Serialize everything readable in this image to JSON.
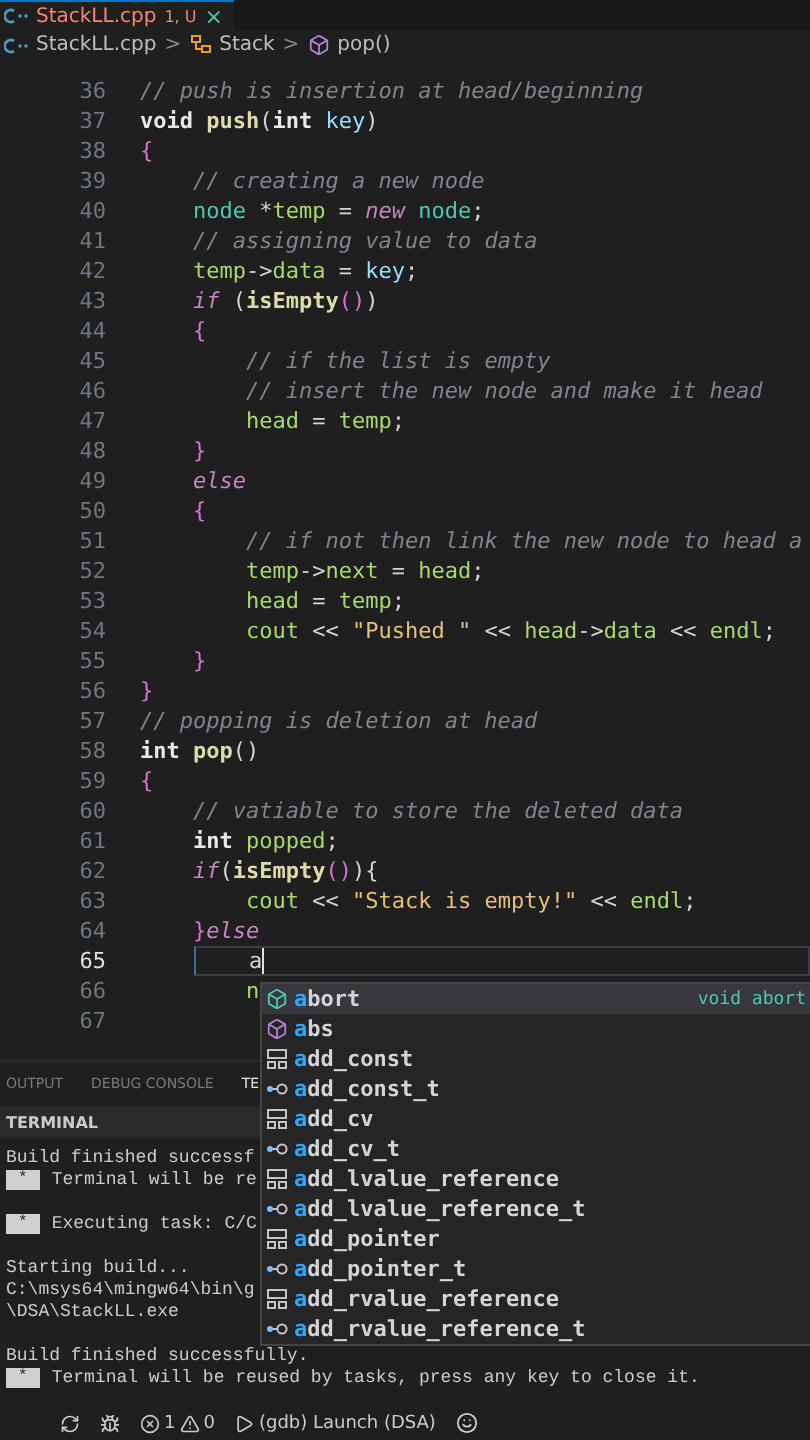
{
  "tab": {
    "file": "StackLL.cpp",
    "badge": "1, U",
    "close": "×"
  },
  "breadcrumb": [
    {
      "kind": "file",
      "label": "StackLL.cpp"
    },
    {
      "kind": "class",
      "label": "Stack"
    },
    {
      "kind": "method",
      "label": "pop()"
    }
  ],
  "separator": ">",
  "code_lines": [
    {
      "number": "36",
      "current": false,
      "tokens": [
        {
          "text": "// push is insertion at head/beginning",
          "kind": "comment"
        }
      ]
    },
    {
      "number": "37",
      "current": false,
      "tokens": [
        {
          "text": "void",
          "kind": "type"
        },
        {
          "text": " push",
          "kind": "func"
        },
        {
          "text": "(",
          "kind": "plain"
        },
        {
          "text": "int",
          "kind": "type"
        },
        {
          "text": " key",
          "kind": "param"
        },
        {
          "text": ")",
          "kind": "plain"
        }
      ]
    },
    {
      "number": "38",
      "current": false,
      "tokens": [
        {
          "text": "{",
          "kind": "brace"
        }
      ]
    },
    {
      "number": "39",
      "current": false,
      "tokens": [
        {
          "text": "    // creating a new node",
          "kind": "comment"
        }
      ]
    },
    {
      "number": "40",
      "current": false,
      "tokens": [
        {
          "text": "    node",
          "kind": "class"
        },
        {
          "text": " *",
          "kind": "plain"
        },
        {
          "text": "temp",
          "kind": "var"
        },
        {
          "text": " = ",
          "kind": "plain"
        },
        {
          "text": "new",
          "kind": "keyword"
        },
        {
          "text": " node",
          "kind": "class"
        },
        {
          "text": ";",
          "kind": "plain"
        }
      ]
    },
    {
      "number": "41",
      "current": false,
      "tokens": [
        {
          "text": "    // assigning value to data",
          "kind": "comment"
        }
      ]
    },
    {
      "number": "42",
      "current": false,
      "tokens": [
        {
          "text": "    temp",
          "kind": "var"
        },
        {
          "text": "->",
          "kind": "plain"
        },
        {
          "text": "data",
          "kind": "var"
        },
        {
          "text": " = ",
          "kind": "plain"
        },
        {
          "text": "key",
          "kind": "param"
        },
        {
          "text": ";",
          "kind": "plain"
        }
      ]
    },
    {
      "number": "43",
      "current": false,
      "tokens": [
        {
          "text": "    if",
          "kind": "keyword"
        },
        {
          "text": " (",
          "kind": "plain"
        },
        {
          "text": "isEmpty",
          "kind": "func"
        },
        {
          "text": "()",
          "kind": "brace"
        },
        {
          "text": ")",
          "kind": "plain"
        }
      ]
    },
    {
      "number": "44",
      "current": false,
      "tokens": [
        {
          "text": "    {",
          "kind": "brace"
        }
      ]
    },
    {
      "number": "45",
      "current": false,
      "tokens": [
        {
          "text": "        // if the list is empty",
          "kind": "comment"
        }
      ]
    },
    {
      "number": "46",
      "current": false,
      "tokens": [
        {
          "text": "        // insert the new node and make it head",
          "kind": "comment"
        }
      ]
    },
    {
      "number": "47",
      "current": false,
      "tokens": [
        {
          "text": "        head",
          "kind": "var"
        },
        {
          "text": " = ",
          "kind": "plain"
        },
        {
          "text": "temp",
          "kind": "var"
        },
        {
          "text": ";",
          "kind": "plain"
        }
      ]
    },
    {
      "number": "48",
      "current": false,
      "tokens": [
        {
          "text": "    }",
          "kind": "brace"
        }
      ]
    },
    {
      "number": "49",
      "current": false,
      "tokens": [
        {
          "text": "    else",
          "kind": "keyword"
        }
      ]
    },
    {
      "number": "50",
      "current": false,
      "tokens": [
        {
          "text": "    {",
          "kind": "brace"
        }
      ]
    },
    {
      "number": "51",
      "current": false,
      "tokens": [
        {
          "text": "        // if not then link the new node to head a",
          "kind": "comment"
        }
      ]
    },
    {
      "number": "52",
      "current": false,
      "tokens": [
        {
          "text": "        temp",
          "kind": "var"
        },
        {
          "text": "->",
          "kind": "plain"
        },
        {
          "text": "next",
          "kind": "var"
        },
        {
          "text": " = ",
          "kind": "plain"
        },
        {
          "text": "head",
          "kind": "var"
        },
        {
          "text": ";",
          "kind": "plain"
        }
      ]
    },
    {
      "number": "53",
      "current": false,
      "tokens": [
        {
          "text": "        head",
          "kind": "var"
        },
        {
          "text": " = ",
          "kind": "plain"
        },
        {
          "text": "temp",
          "kind": "var"
        },
        {
          "text": ";",
          "kind": "plain"
        }
      ]
    },
    {
      "number": "54",
      "current": false,
      "tokens": [
        {
          "text": "        cout",
          "kind": "var"
        },
        {
          "text": " << ",
          "kind": "plain"
        },
        {
          "text": "\"Pushed \"",
          "kind": "string"
        },
        {
          "text": " << ",
          "kind": "plain"
        },
        {
          "text": "head",
          "kind": "var"
        },
        {
          "text": "->",
          "kind": "plain"
        },
        {
          "text": "data",
          "kind": "var"
        },
        {
          "text": " << ",
          "kind": "plain"
        },
        {
          "text": "endl",
          "kind": "var"
        },
        {
          "text": ";",
          "kind": "plain"
        }
      ]
    },
    {
      "number": "55",
      "current": false,
      "tokens": [
        {
          "text": "    }",
          "kind": "brace"
        }
      ]
    },
    {
      "number": "56",
      "current": false,
      "tokens": [
        {
          "text": "}",
          "kind": "brace"
        }
      ]
    },
    {
      "number": "57",
      "current": false,
      "tokens": [
        {
          "text": "// popping is deletion at head",
          "kind": "comment"
        }
      ]
    },
    {
      "number": "58",
      "current": false,
      "tokens": [
        {
          "text": "int",
          "kind": "type"
        },
        {
          "text": " pop",
          "kind": "func"
        },
        {
          "text": "()",
          "kind": "plain"
        }
      ]
    },
    {
      "number": "59",
      "current": false,
      "tokens": [
        {
          "text": "{",
          "kind": "brace"
        }
      ]
    },
    {
      "number": "60",
      "current": false,
      "tokens": [
        {
          "text": "    // vatiable to store the deleted data",
          "kind": "comment"
        }
      ]
    },
    {
      "number": "61",
      "current": false,
      "tokens": [
        {
          "text": "    int",
          "kind": "type"
        },
        {
          "text": " popped",
          "kind": "var"
        },
        {
          "text": ";",
          "kind": "plain"
        }
      ]
    },
    {
      "number": "62",
      "current": false,
      "tokens": [
        {
          "text": "    if",
          "kind": "keyword"
        },
        {
          "text": "(",
          "kind": "plain"
        },
        {
          "text": "isEmpty",
          "kind": "func"
        },
        {
          "text": "()",
          "kind": "brace"
        },
        {
          "text": "){",
          "kind": "plain"
        }
      ]
    },
    {
      "number": "63",
      "current": false,
      "tokens": [
        {
          "text": "        cout",
          "kind": "var"
        },
        {
          "text": " << ",
          "kind": "plain"
        },
        {
          "text": "\"Stack is empty!\"",
          "kind": "string"
        },
        {
          "text": " << ",
          "kind": "plain"
        },
        {
          "text": "endl",
          "kind": "var"
        },
        {
          "text": ";",
          "kind": "plain"
        }
      ]
    },
    {
      "number": "64",
      "current": false,
      "tokens": [
        {
          "text": "    }",
          "kind": "brace"
        },
        {
          "text": "else",
          "kind": "keyword"
        }
      ]
    },
    {
      "number": "65",
      "current": true,
      "tokens": [
        {
          "text": "        a",
          "kind": "plain"
        }
      ]
    },
    {
      "number": "66",
      "current": false,
      "tokens": [
        {
          "text": "        n",
          "kind": "var"
        }
      ]
    },
    {
      "number": "67",
      "current": false
    }
  ],
  "suggestions": [
    {
      "label": "abort",
      "kind": "function",
      "selected": true,
      "detail": "void abort"
    },
    {
      "label": "abs",
      "kind": "function",
      "selected": false
    },
    {
      "label": "add_const",
      "kind": "struct",
      "selected": false
    },
    {
      "label": "add_const_t",
      "kind": "typedef",
      "selected": false
    },
    {
      "label": "add_cv",
      "kind": "struct",
      "selected": false
    },
    {
      "label": "add_cv_t",
      "kind": "typedef",
      "selected": false
    },
    {
      "label": "add_lvalue_reference",
      "kind": "struct",
      "selected": false
    },
    {
      "label": "add_lvalue_reference_t",
      "kind": "typedef",
      "selected": false
    },
    {
      "label": "add_pointer",
      "kind": "struct",
      "selected": false
    },
    {
      "label": "add_pointer_t",
      "kind": "typedef",
      "selected": false
    },
    {
      "label": "add_rvalue_reference",
      "kind": "struct",
      "selected": false
    },
    {
      "label": "add_rvalue_reference_t",
      "kind": "typedef",
      "selected": false
    }
  ],
  "panel_tabs": [
    {
      "label": "OUTPUT",
      "selected": false
    },
    {
      "label": "DEBUG CONSOLE",
      "selected": false
    },
    {
      "label": "TE",
      "selected": true
    }
  ],
  "terminal": {
    "title": "TERMINAL",
    "lines": [
      {
        "kind": "text",
        "text": "Build finished successf"
      },
      {
        "kind": "task",
        "badge": "*",
        "text": "Terminal will be re"
      },
      {
        "kind": "blank"
      },
      {
        "kind": "task",
        "badge": "*",
        "text": "Executing task: C/C"
      },
      {
        "kind": "blank"
      },
      {
        "kind": "text",
        "text": "Starting build..."
      },
      {
        "kind": "text",
        "text": "C:\\msys64\\mingw64\\bin\\g"
      },
      {
        "kind": "text",
        "text": "\\DSA\\StackLL.exe"
      },
      {
        "kind": "blank"
      },
      {
        "kind": "text",
        "text": "Build finished successfully."
      },
      {
        "kind": "task",
        "badge": "*",
        "text": "Terminal will be reused by tasks, press any key to close it."
      }
    ]
  },
  "status_bar": {
    "errors": "1",
    "warnings": "0",
    "launch": "(gdb) Launch (DSA)"
  }
}
